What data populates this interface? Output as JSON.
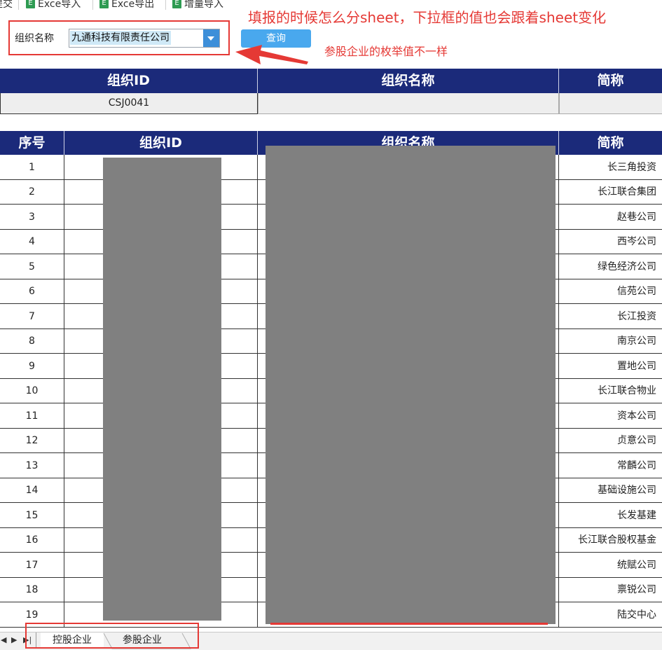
{
  "toolbar": {
    "items": [
      {
        "label": "提交",
        "icon": "excel-icon"
      },
      {
        "label": "Exce导入",
        "icon": "excel-icon"
      },
      {
        "label": "Exce导出",
        "icon": "excel-icon"
      },
      {
        "label": "增量导入",
        "icon": "excel-icon"
      }
    ]
  },
  "filter": {
    "label": "组织名称",
    "selected": "九通科技有限责任公司",
    "query_label": "查询"
  },
  "annotations": {
    "main": "填报的时候怎么分sheet，下拉框的值也会跟着sheet变化",
    "sub": "参股企业的枚举值不一样"
  },
  "summary_table": {
    "headers": [
      "组织ID",
      "组织名称",
      "简称"
    ],
    "row": {
      "org_id": "CSJ0041",
      "org_name": "",
      "short_name": ""
    }
  },
  "detail_table": {
    "headers": [
      "序号",
      "组织ID",
      "组织名称",
      "简称"
    ],
    "rows": [
      {
        "seq": "1",
        "short": "长三角投资"
      },
      {
        "seq": "2",
        "short": "长江联合集团"
      },
      {
        "seq": "3",
        "short": "赵巷公司"
      },
      {
        "seq": "4",
        "short": "西岑公司"
      },
      {
        "seq": "5",
        "short": "绿色经济公司"
      },
      {
        "seq": "6",
        "short": "信苑公司"
      },
      {
        "seq": "7",
        "short": "长江投资"
      },
      {
        "seq": "8",
        "short": "南京公司"
      },
      {
        "seq": "9",
        "short": "置地公司"
      },
      {
        "seq": "10",
        "short": "长江联合物业"
      },
      {
        "seq": "11",
        "short": "资本公司"
      },
      {
        "seq": "12",
        "short": "贞意公司"
      },
      {
        "seq": "13",
        "short": "常麟公司"
      },
      {
        "seq": "14",
        "short": "基础设施公司"
      },
      {
        "seq": "15",
        "short": "长发基建"
      },
      {
        "seq": "16",
        "short": "长江联合股权基金"
      },
      {
        "seq": "17",
        "short": "统赋公司"
      },
      {
        "seq": "18",
        "short": "禀锐公司"
      },
      {
        "seq": "19",
        "short": "陆交中心"
      }
    ]
  },
  "sheets": {
    "tabs": [
      "控股企业",
      "参股企业"
    ],
    "nav_icons": [
      "prev-sheet-icon",
      "next-sheet-icon",
      "last-sheet-icon"
    ]
  },
  "colors": {
    "header_bg": "#1b2a7a",
    "annotation": "#e53935",
    "query_button": "#49a8ee",
    "dropdown_button": "#3d8fd9",
    "mask": "#808080"
  }
}
